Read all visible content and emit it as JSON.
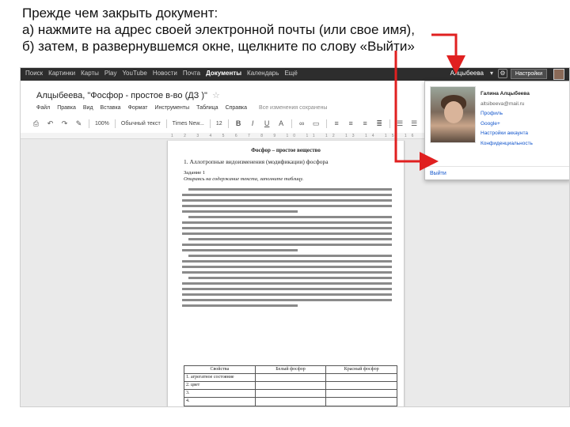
{
  "instructions": {
    "line1": "Прежде чем закрыть документ:",
    "line2": "а) нажмите на адрес своей электронной почты (или свое имя),",
    "line3": "б) затем, в развернувшемся окне, щелкните по слову «Выйти»"
  },
  "google_bar": {
    "nav": [
      "Поиск",
      "Картинки",
      "Карты",
      "Play",
      "YouTube",
      "Новости",
      "Почта",
      "Документы",
      "Календарь",
      "Ещё"
    ],
    "active_index": 7,
    "user_name": "Алцыбеева",
    "share_label": "Настройки",
    "gear": "gear-icon"
  },
  "document": {
    "title": "Алцыбеева, \"Фосфор - простое в-во (ДЗ )\"",
    "menu": [
      "Файл",
      "Правка",
      "Вид",
      "Вставка",
      "Формат",
      "Инструменты",
      "Таблица",
      "Справка"
    ],
    "saved_status": "Все изменения сохранены",
    "toolbar": {
      "zoom": "100%",
      "style": "Обычный текст",
      "font": "Times New...",
      "size": "12"
    },
    "page": {
      "heading": "Фосфор – простое вещество",
      "section": "1. Аллотропные видоизменения (модификации) фосфора",
      "task_label": "Задание 1",
      "task_desc": "Опираясь на содержание текста, заполните таблицу."
    },
    "table": {
      "headers": [
        "Свойства",
        "Белый фосфор",
        "Красный фосфор"
      ],
      "rows": [
        [
          "1. агрегатное состояние",
          "",
          ""
        ],
        [
          "2. цвет",
          "",
          ""
        ],
        [
          "3.",
          "",
          ""
        ],
        [
          "4.",
          "",
          ""
        ]
      ]
    }
  },
  "account_popup": {
    "name": "Галина Алцыбеева",
    "email": "altsibeeva@mail.ru",
    "links": [
      "Профиль",
      "Google+",
      "Настройки аккаунта",
      "Конфиденциальность"
    ],
    "logout": "Выйти"
  },
  "colors": {
    "arrow": "#e02020",
    "gbar": "#2d2d2d",
    "link": "#1155cc"
  }
}
